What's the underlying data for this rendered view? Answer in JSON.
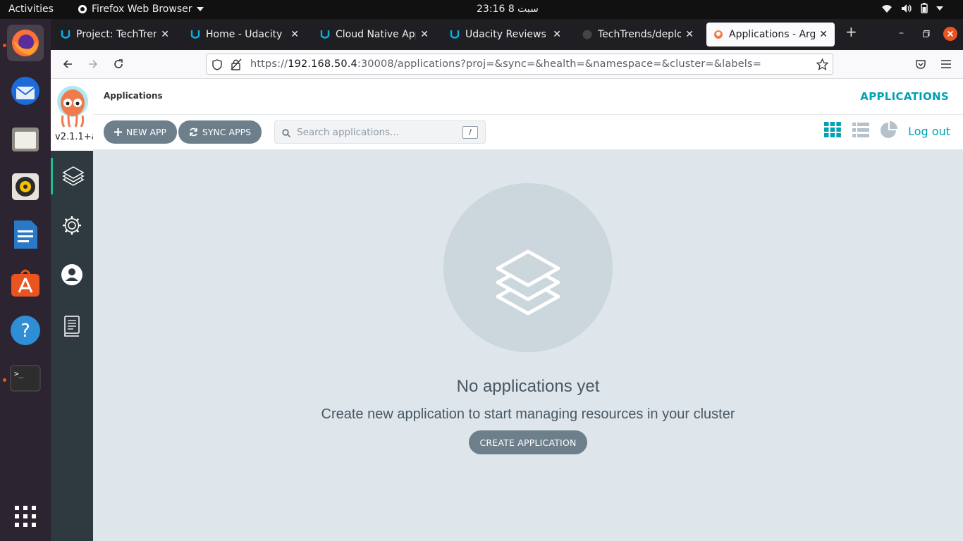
{
  "topbar": {
    "activities": "Activities",
    "app_name": "Firefox Web Browser",
    "clock": "سبت 8  23:16"
  },
  "dock": {
    "items": [
      {
        "name": "firefox-icon",
        "active": true
      },
      {
        "name": "thunderbird-icon"
      },
      {
        "name": "files-icon"
      },
      {
        "name": "rhythmbox-icon"
      },
      {
        "name": "libreoffice-writer-icon"
      },
      {
        "name": "ubuntu-software-icon"
      },
      {
        "name": "help-icon",
        "label": "?"
      },
      {
        "name": "terminal-icon",
        "label": ">_"
      },
      {
        "name": "show-apps-icon"
      }
    ]
  },
  "browser": {
    "tabs": [
      {
        "title": "Project: TechTrends"
      },
      {
        "title": "Home - Udacity"
      },
      {
        "title": "Cloud Native Applic"
      },
      {
        "title": "Udacity Reviews"
      },
      {
        "title": "TechTrends/deploy"
      },
      {
        "title": "Applications - Argo",
        "active": true
      }
    ],
    "url_prefix": "https://",
    "url_host": "192.168.50.4",
    "url_rest": ":30008/applications?proj=&sync=&health=&namespace=&cluster=&labels="
  },
  "argo": {
    "version": "v2.1.1+a",
    "breadcrumb": "Applications",
    "page_title": "APPLICATIONS",
    "toolbar": {
      "new_app": "NEW APP",
      "sync_apps": "SYNC APPS",
      "search_placeholder": "Search applications...",
      "search_shortcut": "/",
      "logout": "Log out"
    },
    "empty": {
      "title": "No applications yet",
      "subtitle": "Create new application to start managing resources in your cluster",
      "button": "CREATE APPLICATION"
    },
    "colors": {
      "accent": "#00a2b3",
      "sidebar": "#2f3a40",
      "button": "#6d7f8b",
      "main_bg": "#dee6eb"
    }
  }
}
